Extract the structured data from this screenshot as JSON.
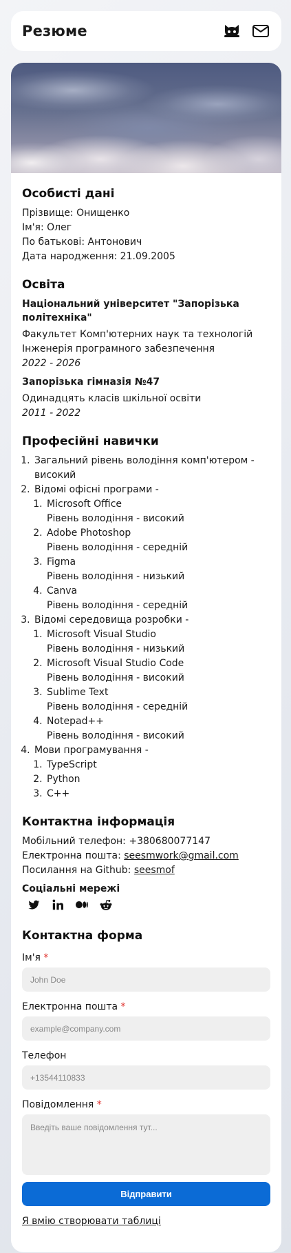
{
  "header": {
    "title": "Резюме",
    "github_icon": "github-icon",
    "mail_icon": "mail-icon"
  },
  "personal": {
    "heading": "Особисті дані",
    "surname": "Прізвище: Онищенко",
    "name": "Ім'я: Олег",
    "patronymic": "По батькові: Антонович",
    "birthdate": "Дата народження: 21.09.2005"
  },
  "education": {
    "heading": "Освіта",
    "items": [
      {
        "institution": "Національний університет \"Запорізька політехніка\"",
        "line1": "Факультет Комп'ютерних наук та технологій",
        "line2": "Інженерія програмного забезпечення",
        "years": "2022 - 2026"
      },
      {
        "institution": "Запорізька гімназія №47",
        "line1": "Одинадцять класів шкільної освіти",
        "years": "2011 - 2022"
      }
    ]
  },
  "skills": {
    "heading": "Професійні навички",
    "general": "Загальний рівень володіння комп'ютером - високий",
    "office_label": "Відомі офісні програми -",
    "office": [
      {
        "name": "Microsoft Office",
        "level": "Рівень володіння - високий"
      },
      {
        "name": "Adobe Photoshop",
        "level": "Рівень володіння - середній"
      },
      {
        "name": "Figma",
        "level": "Рівень володіння - низький"
      },
      {
        "name": "Canva",
        "level": "Рівень володіння - середній"
      }
    ],
    "ide_label": "Відомі середовища розробки -",
    "ide": [
      {
        "name": "Microsoft Visual Studio",
        "level": "Рівень володіння - низький"
      },
      {
        "name": "Microsoft Visual Studio Code",
        "level": "Рівень володіння - високий"
      },
      {
        "name": "Sublime Text",
        "level": "Рівень володіння - середній"
      },
      {
        "name": "Notepad++",
        "level": "Рівень володіння - високий"
      }
    ],
    "langs_label": "Мови програмування -",
    "langs": [
      "TypeScript",
      "Python",
      "C++"
    ]
  },
  "contact": {
    "heading": "Контактна інформація",
    "phone": "Мобільний телефон: +380680077147",
    "email_label": "Електронна пошта: ",
    "email": "seesmwork@gmail.com",
    "github_label": "Посилання на Github: ",
    "github": "seesmof",
    "social_heading": "Соціальні мережі",
    "social_icons": [
      "twitter-icon",
      "linkedin-icon",
      "medium-icon",
      "reddit-icon"
    ]
  },
  "form": {
    "heading": "Контактна форма",
    "name_label": "Ім'я",
    "name_placeholder": "John Doe",
    "email_label": "Електронна пошта",
    "email_placeholder": "example@company.com",
    "phone_label": "Телефон",
    "phone_placeholder": "+13544110833",
    "message_label": "Повідомлення",
    "message_placeholder": "Введіть ваше повідомлення тут...",
    "required_mark": "*",
    "submit": "Відправити"
  },
  "footer_link": "Я вмію створювати таблиці"
}
